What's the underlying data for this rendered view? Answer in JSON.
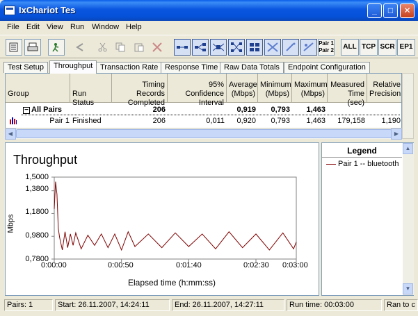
{
  "window": {
    "title": "IxChariot Tes"
  },
  "menu": [
    "File",
    "Edit",
    "View",
    "Run",
    "Window",
    "Help"
  ],
  "toolbar": {
    "pair_label_1": "Pair 1",
    "pair_label_2": "Pair 2",
    "all": "ALL",
    "tcp": "TCP",
    "scr": "SCR",
    "ep1": "EP1"
  },
  "tabs": [
    "Test Setup",
    "Throughput",
    "Transaction Rate",
    "Response Time",
    "Raw Data Totals",
    "Endpoint Configuration"
  ],
  "active_tab": "Throughput",
  "grid": {
    "headers": {
      "group": "Group",
      "run_status": "Run Status",
      "timing_1": "Timing Records",
      "timing_2": "Completed",
      "conf_1": "95% Confidence",
      "conf_2": "Interval",
      "avg_1": "Average",
      "avg_2": "(Mbps)",
      "min_1": "Minimum",
      "min_2": "(Mbps)",
      "max_1": "Maximum",
      "max_2": "(Mbps)",
      "meas_1": "Measured",
      "meas_2": "Time (sec)",
      "rel_1": "Relative",
      "rel_2": "Precision"
    },
    "all_pairs": {
      "group": "All Pairs",
      "expand": "−",
      "timing": "206",
      "avg": "0,919",
      "min": "0,793",
      "max": "1,463"
    },
    "pair1": {
      "group": "Pair 1",
      "status": "Finished",
      "timing": "206",
      "conf": "0,011",
      "avg": "0,920",
      "min": "0,793",
      "max": "1,463",
      "time": "179,158",
      "rel": "1,190"
    }
  },
  "chart": {
    "title": "Throughput",
    "ylabel": "Mbps",
    "xlabel": "Elapsed time (h:mm:ss)",
    "yticks": [
      "1,5000",
      "1,3800",
      "1,1800",
      "0,9800",
      "0,7800"
    ],
    "xticks": [
      "0:00:00",
      "0:00:50",
      "0:01:40",
      "0:02:30",
      "0:03:00"
    ]
  },
  "chart_data": {
    "type": "line",
    "xlabel": "Elapsed time (h:mm:ss)",
    "ylabel": "Mbps",
    "title": "Throughput",
    "xlim_seconds": [
      0,
      180
    ],
    "ylim": [
      0.78,
      1.5
    ],
    "series": [
      {
        "name": "Pair 1 -- bluetooth",
        "color": "#800000",
        "x": [
          0,
          1,
          2,
          3,
          4,
          6,
          8,
          10,
          12,
          14,
          16,
          20,
          25,
          30,
          35,
          40,
          45,
          50,
          55,
          60,
          70,
          80,
          90,
          100,
          110,
          120,
          130,
          140,
          150,
          160,
          170,
          178,
          180
        ],
        "y": [
          1.22,
          1.46,
          1.35,
          1.05,
          0.97,
          0.86,
          1.02,
          0.88,
          1.0,
          0.9,
          1.01,
          0.87,
          0.99,
          0.9,
          1.0,
          0.88,
          1.0,
          0.86,
          1.02,
          0.89,
          1.0,
          0.88,
          1.01,
          0.89,
          1.0,
          0.87,
          1.02,
          0.88,
          1.0,
          0.86,
          1.01,
          0.87,
          0.93
        ]
      }
    ]
  },
  "legend": {
    "title": "Legend",
    "entry": "Pair 1 -- bluetooth"
  },
  "status": {
    "pairs": "Pairs: 1",
    "start": "Start: 26.11.2007, 14:24:11",
    "end": "End: 26.11.2007, 14:27:11",
    "runtime": "Run time: 00:03:00",
    "ran": "Ran to c"
  }
}
